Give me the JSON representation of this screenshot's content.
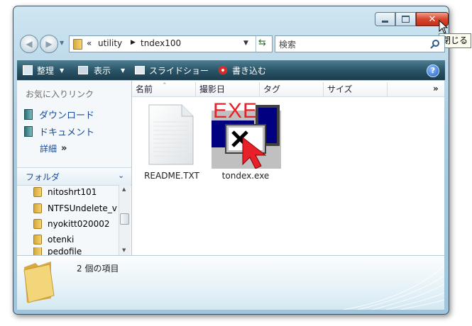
{
  "window": {
    "tooltip": "閉じる"
  },
  "address": {
    "overflow": "«",
    "crumbs": [
      "utility",
      "tndex100"
    ]
  },
  "search": {
    "placeholder": "検索"
  },
  "toolbar": {
    "organize": "整理",
    "view": "表示",
    "slideshow": "スライドショー",
    "burn": "書き込む"
  },
  "left": {
    "favorites_title": "お気に入りリンク",
    "links": [
      "ダウンロード",
      "ドキュメント"
    ],
    "more": "詳細",
    "folders_title": "フォルダ",
    "folders": [
      "nitoshrt101",
      "NTFSUndelete_v",
      "nyokitt020002",
      "otenki",
      "pedofile"
    ]
  },
  "columns": [
    "名前",
    "撮影日",
    "タグ",
    "サイズ"
  ],
  "files": [
    {
      "name": "README.TXT",
      "icon": "text-file-icon"
    },
    {
      "name": "tondex.exe",
      "icon": "exe-icon",
      "badge": "EXE"
    }
  ],
  "status": {
    "count_text": "2 個の項目"
  },
  "colors": {
    "toolbar": "#2b5568",
    "link": "#1a4a92",
    "close": "#d6462c",
    "exe_badge": "#e8202a"
  }
}
